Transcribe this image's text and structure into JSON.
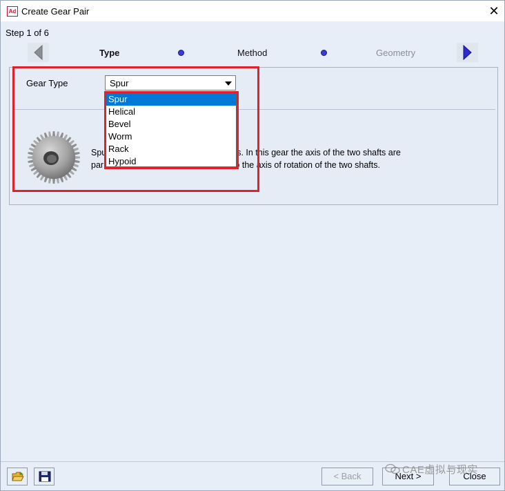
{
  "window": {
    "app_icon_text": "Ad",
    "title": "Create Gear Pair",
    "close_glyph": "✕"
  },
  "wizard": {
    "step_text": "Step 1 of 6",
    "steps": [
      {
        "label": "Type",
        "state": "current"
      },
      {
        "label": "Method",
        "state": "pending"
      },
      {
        "label": "Geometry",
        "state": "disabled"
      }
    ],
    "prev_icon": "triangle-left-icon",
    "next_icon": "triangle-right-icon"
  },
  "form": {
    "gear_type_label": "Gear Type",
    "gear_type_value": "Spur",
    "options": [
      "Spur",
      "Helical",
      "Bevel",
      "Worm",
      "Rack",
      "Hypoid"
    ],
    "selected_option": "Spur"
  },
  "description": {
    "line1_start": "Spu",
    "line1_end": "t gears. In this gear the axis of the two shafts are",
    "line2_start": "par",
    "line2_end": "rallel to the axis of rotation of the two shafts."
  },
  "footer": {
    "open_icon": "folder-open-icon",
    "save_icon": "floppy-disk-icon",
    "back_label": "< Back",
    "next_label": "Next >",
    "close_label": "Close"
  },
  "watermark": {
    "text": "CAE虚拟与现实",
    "icon": "wechat-icon"
  },
  "colors": {
    "highlight": "#e0202a",
    "selection": "#0078d7",
    "dialog_bg": "#e7eef8",
    "step_dot": "#3a3ad6"
  }
}
